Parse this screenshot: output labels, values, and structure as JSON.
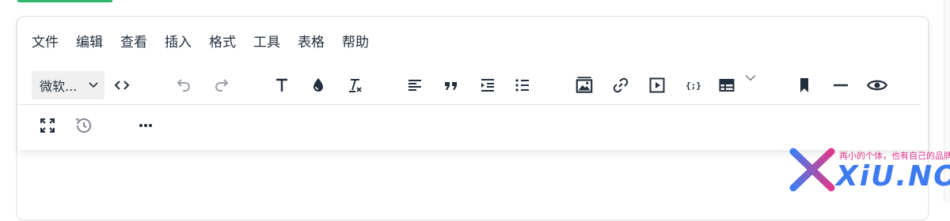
{
  "menubar": {
    "items": [
      "文件",
      "编辑",
      "查看",
      "插入",
      "格式",
      "工具",
      "表格",
      "帮助"
    ]
  },
  "toolbar": {
    "font_family": "微软...",
    "icons": [
      "source-code-icon",
      "undo-icon",
      "redo-icon",
      "text-icon",
      "color-drop-icon",
      "clear-format-icon",
      "align-left-icon",
      "blockquote-icon",
      "indent-icon",
      "bullet-list-icon",
      "image-icon",
      "link-icon",
      "media-icon",
      "code-sample-icon",
      "table-icon",
      "bookmark-icon",
      "horizontal-rule-icon",
      "preview-icon",
      "fullscreen-icon",
      "history-icon",
      "more-icon"
    ],
    "disabled": [
      "undo-icon",
      "redo-icon"
    ]
  },
  "watermark": {
    "brand": "XiU.NO",
    "slogan": "再小的个体，也有自己的品牌"
  },
  "colors": {
    "icon": "#222f3e",
    "accent_green": "#31b46b",
    "watermark_blue": "#3f7bf0",
    "watermark_pink": "#e0388a"
  }
}
